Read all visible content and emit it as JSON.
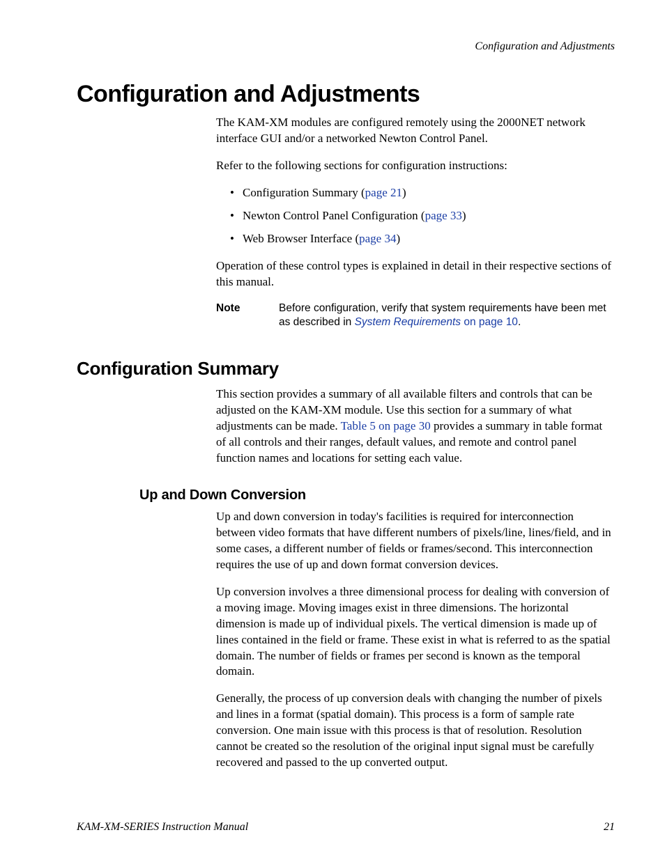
{
  "running_header": "Configuration and Adjustments",
  "h1": "Configuration and Adjustments",
  "intro_p1": "The KAM-XM modules are configured remotely using the 2000NET network interface GUI and/or a networked Newton Control Panel.",
  "intro_p2": "Refer to the following sections for configuration instructions:",
  "bullets": {
    "b1_text": "Configuration Summary (",
    "b1_link": "page 21",
    "b1_close": ")",
    "b2_text": "Newton Control Panel Configuration (",
    "b2_link": "page 33",
    "b2_close": ")",
    "b3_text": "Web Browser Interface (",
    "b3_link": "page 34",
    "b3_close": ")"
  },
  "intro_p3": "Operation of these control types is explained in detail in their respective sections of this manual.",
  "note": {
    "label": "Note",
    "text_a": "Before configuration, verify that system requirements have been met as described in ",
    "link1": "System Requirements",
    "mid": " on page 10",
    "text_b": "."
  },
  "h2": "Configuration Summary",
  "cs_p1_a": "This section provides a summary of all available filters and controls that can be adjusted on the KAM-XM module. Use this section for a summary of what adjustments can be made. ",
  "cs_p1_link": "Table 5 on page 30",
  "cs_p1_b": " provides a summary in table format of all controls and their ranges, default values, and remote and control panel function names and locations for setting each value.",
  "h3": "Up and Down Conversion",
  "ud_p1": "Up and down conversion in today's facilities is required for interconnection between video formats that have different numbers of pixels/line, lines/field, and in some cases, a different number of fields or frames/second. This interconnection requires the use of up and down format conversion devices.",
  "ud_p2": "Up conversion involves a three dimensional process for dealing with conversion of a moving image. Moving images exist in three dimensions. The horizontal dimension is made up of individual pixels. The vertical dimension is made up of lines contained in the field or frame. These exist in what is referred to as the spatial domain. The number of fields or frames per second is known as the temporal domain.",
  "ud_p3": "Generally, the process of up conversion deals with changing the number of pixels and lines in a format (spatial domain). This process is a form of sample rate conversion. One main issue with this process is that of resolution. Resolution cannot be created so the resolution of the original input signal must be carefully recovered and passed to the up converted output.",
  "footer": {
    "left": "KAM-XM-SERIES Instruction Manual",
    "right": "21"
  }
}
